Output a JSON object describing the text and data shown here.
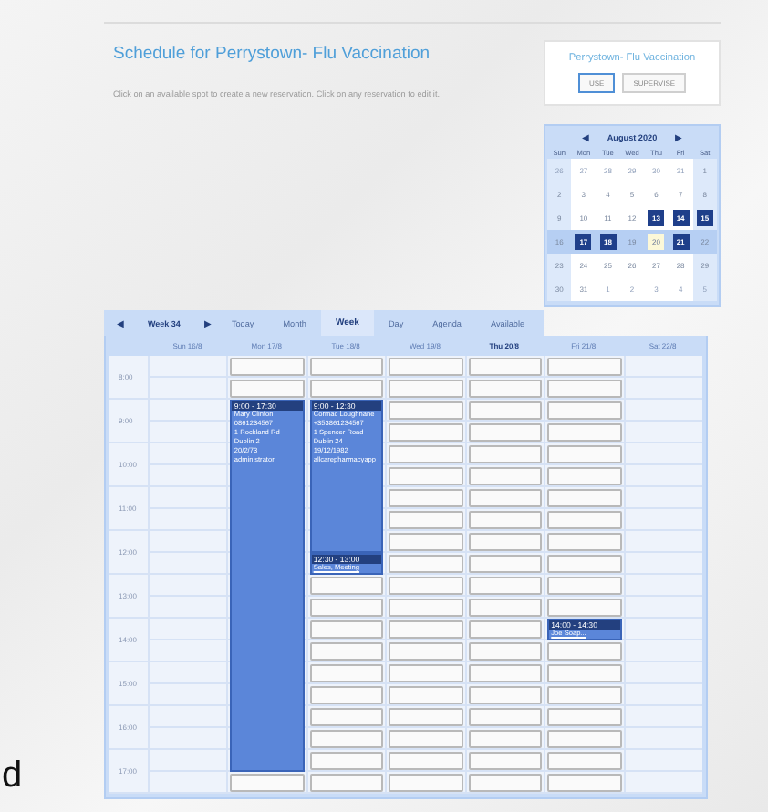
{
  "page": {
    "title": "Schedule for Perrystown- Flu Vaccination",
    "instructions": "Click on an available spot to create a new reservation. Click on any reservation to edit it."
  },
  "resource_card": {
    "title": "Perrystown- Flu Vaccination",
    "modes": [
      {
        "label": "USE",
        "selected": true
      },
      {
        "label": "SUPERVISE",
        "selected": false
      }
    ]
  },
  "mini_calendar": {
    "month": "August 2020",
    "prev": "◀",
    "next": "▶",
    "weekdays": [
      "Sun",
      "Mon",
      "Tue",
      "Wed",
      "Thu",
      "Fri",
      "Sat"
    ],
    "weeks": [
      {
        "selected": false,
        "days": [
          {
            "label": "26",
            "kind": "other"
          },
          {
            "label": "27",
            "kind": "other"
          },
          {
            "label": "28",
            "kind": "other"
          },
          {
            "label": "29",
            "kind": "other"
          },
          {
            "label": "30",
            "kind": "other"
          },
          {
            "label": "31",
            "kind": "other"
          },
          {
            "label": "1",
            "kind": "day"
          }
        ]
      },
      {
        "selected": false,
        "days": [
          {
            "label": "2",
            "kind": "day"
          },
          {
            "label": "3",
            "kind": "day"
          },
          {
            "label": "4",
            "kind": "day"
          },
          {
            "label": "5",
            "kind": "day"
          },
          {
            "label": "6",
            "kind": "day"
          },
          {
            "label": "7",
            "kind": "day"
          },
          {
            "label": "8",
            "kind": "day"
          }
        ]
      },
      {
        "selected": false,
        "days": [
          {
            "label": "9",
            "kind": "day"
          },
          {
            "label": "10",
            "kind": "day"
          },
          {
            "label": "11",
            "kind": "day"
          },
          {
            "label": "12",
            "kind": "day"
          },
          {
            "label": "13",
            "kind": "booked"
          },
          {
            "label": "14",
            "kind": "booked"
          },
          {
            "label": "15",
            "kind": "booked"
          }
        ]
      },
      {
        "selected": true,
        "days": [
          {
            "label": "16",
            "kind": "day"
          },
          {
            "label": "17",
            "kind": "booked"
          },
          {
            "label": "18",
            "kind": "booked"
          },
          {
            "label": "19",
            "kind": "day"
          },
          {
            "label": "20",
            "kind": "today"
          },
          {
            "label": "21",
            "kind": "booked"
          },
          {
            "label": "22",
            "kind": "day"
          }
        ]
      },
      {
        "selected": false,
        "days": [
          {
            "label": "23",
            "kind": "day"
          },
          {
            "label": "24",
            "kind": "day"
          },
          {
            "label": "25",
            "kind": "day"
          },
          {
            "label": "26",
            "kind": "day"
          },
          {
            "label": "27",
            "kind": "day"
          },
          {
            "label": "28",
            "kind": "day"
          },
          {
            "label": "29",
            "kind": "day"
          }
        ]
      },
      {
        "selected": false,
        "days": [
          {
            "label": "30",
            "kind": "day"
          },
          {
            "label": "31",
            "kind": "day"
          },
          {
            "label": "1",
            "kind": "other"
          },
          {
            "label": "2",
            "kind": "other"
          },
          {
            "label": "3",
            "kind": "other"
          },
          {
            "label": "4",
            "kind": "other"
          },
          {
            "label": "5",
            "kind": "other"
          }
        ]
      }
    ]
  },
  "toolbar": {
    "prev": "◀",
    "week": "Week 34",
    "next": "▶",
    "views": [
      {
        "label": "Today",
        "selected": false
      },
      {
        "label": "Month",
        "selected": false
      },
      {
        "label": "Week",
        "selected": true
      },
      {
        "label": "Day",
        "selected": false
      },
      {
        "label": "Agenda",
        "selected": false
      },
      {
        "label": "Available",
        "selected": false
      }
    ]
  },
  "times": [
    "8:00",
    "9:00",
    "10:00",
    "11:00",
    "12:00",
    "13:00",
    "14:00",
    "15:00",
    "16:00",
    "17:00"
  ],
  "columns": [
    {
      "header": "Sun 16/8",
      "today": false
    },
    {
      "header": "Mon 17/8",
      "today": false,
      "cells": [
        {
          "kind": "slot"
        },
        {
          "kind": "slot"
        },
        {
          "kind": "event",
          "time": "9:00 - 17:30",
          "lines": [
            "Mary Clinton",
            "0861234567",
            "1 Rockland Rd",
            "Dublin 2",
            "20/2/73",
            "administrator"
          ]
        },
        {
          "kind": "covered"
        },
        {
          "kind": "covered"
        },
        {
          "kind": "covered"
        },
        {
          "kind": "covered"
        },
        {
          "kind": "covered"
        },
        {
          "kind": "covered"
        },
        {
          "kind": "covered"
        },
        {
          "kind": "covered"
        },
        {
          "kind": "covered"
        },
        {
          "kind": "covered"
        },
        {
          "kind": "covered"
        },
        {
          "kind": "covered"
        },
        {
          "kind": "covered"
        },
        {
          "kind": "covered"
        },
        {
          "kind": "covered"
        },
        {
          "kind": "covered"
        },
        {
          "kind": "slot"
        }
      ]
    },
    {
      "header": "Tue 18/8",
      "today": false,
      "cells": [
        {
          "kind": "slot"
        },
        {
          "kind": "slot"
        },
        {
          "kind": "event",
          "time": "9:00 - 12:30",
          "lines": [
            "Cormac Loughnane",
            "+353861234567",
            "1 Spencer Road",
            "Dublin 24",
            "19/12/1982",
            "allcarepharmacyapp"
          ]
        },
        {
          "kind": "covered"
        },
        {
          "kind": "covered"
        },
        {
          "kind": "covered"
        },
        {
          "kind": "covered"
        },
        {
          "kind": "covered"
        },
        {
          "kind": "covered"
        },
        {
          "kind": "event",
          "time": "12:30 - 13:00",
          "lines": [
            "Sales, Meeting"
          ]
        },
        {
          "kind": "slot"
        },
        {
          "kind": "slot"
        },
        {
          "kind": "slot"
        },
        {
          "kind": "slot"
        },
        {
          "kind": "slot"
        },
        {
          "kind": "slot"
        },
        {
          "kind": "slot"
        },
        {
          "kind": "slot"
        },
        {
          "kind": "slot"
        },
        {
          "kind": "slot"
        }
      ]
    },
    {
      "header": "Wed 19/8",
      "today": false,
      "cells": [
        {
          "kind": "slot"
        },
        {
          "kind": "slot"
        },
        {
          "kind": "slot"
        },
        {
          "kind": "slot"
        },
        {
          "kind": "slot"
        },
        {
          "kind": "slot"
        },
        {
          "kind": "slot"
        },
        {
          "kind": "slot"
        },
        {
          "kind": "slot"
        },
        {
          "kind": "slot"
        },
        {
          "kind": "slot"
        },
        {
          "kind": "slot"
        },
        {
          "kind": "slot"
        },
        {
          "kind": "slot"
        },
        {
          "kind": "slot"
        },
        {
          "kind": "slot"
        },
        {
          "kind": "slot"
        },
        {
          "kind": "slot"
        },
        {
          "kind": "slot"
        },
        {
          "kind": "slot"
        }
      ]
    },
    {
      "header": "Thu 20/8",
      "today": true,
      "cells": [
        {
          "kind": "slot"
        },
        {
          "kind": "slot"
        },
        {
          "kind": "slot"
        },
        {
          "kind": "slot"
        },
        {
          "kind": "slot"
        },
        {
          "kind": "slot"
        },
        {
          "kind": "slot"
        },
        {
          "kind": "slot"
        },
        {
          "kind": "slot"
        },
        {
          "kind": "slot"
        },
        {
          "kind": "slot"
        },
        {
          "kind": "slot"
        },
        {
          "kind": "slot"
        },
        {
          "kind": "slot"
        },
        {
          "kind": "slot"
        },
        {
          "kind": "slot"
        },
        {
          "kind": "slot"
        },
        {
          "kind": "slot"
        },
        {
          "kind": "slot"
        },
        {
          "kind": "slot"
        }
      ]
    },
    {
      "header": "Fri 21/8",
      "today": false,
      "cells": [
        {
          "kind": "slot"
        },
        {
          "kind": "slot"
        },
        {
          "kind": "slot"
        },
        {
          "kind": "slot"
        },
        {
          "kind": "slot"
        },
        {
          "kind": "slot"
        },
        {
          "kind": "slot"
        },
        {
          "kind": "slot"
        },
        {
          "kind": "slot"
        },
        {
          "kind": "slot"
        },
        {
          "kind": "slot"
        },
        {
          "kind": "slot"
        },
        {
          "kind": "event",
          "time": "14:00 - 14:30",
          "lines": [
            "Joe Soap..."
          ]
        },
        {
          "kind": "slot"
        },
        {
          "kind": "slot"
        },
        {
          "kind": "slot"
        },
        {
          "kind": "slot"
        },
        {
          "kind": "slot"
        },
        {
          "kind": "slot"
        },
        {
          "kind": "slot"
        }
      ]
    },
    {
      "header": "Sat 22/8",
      "today": false
    }
  ],
  "stray_text": "d"
}
